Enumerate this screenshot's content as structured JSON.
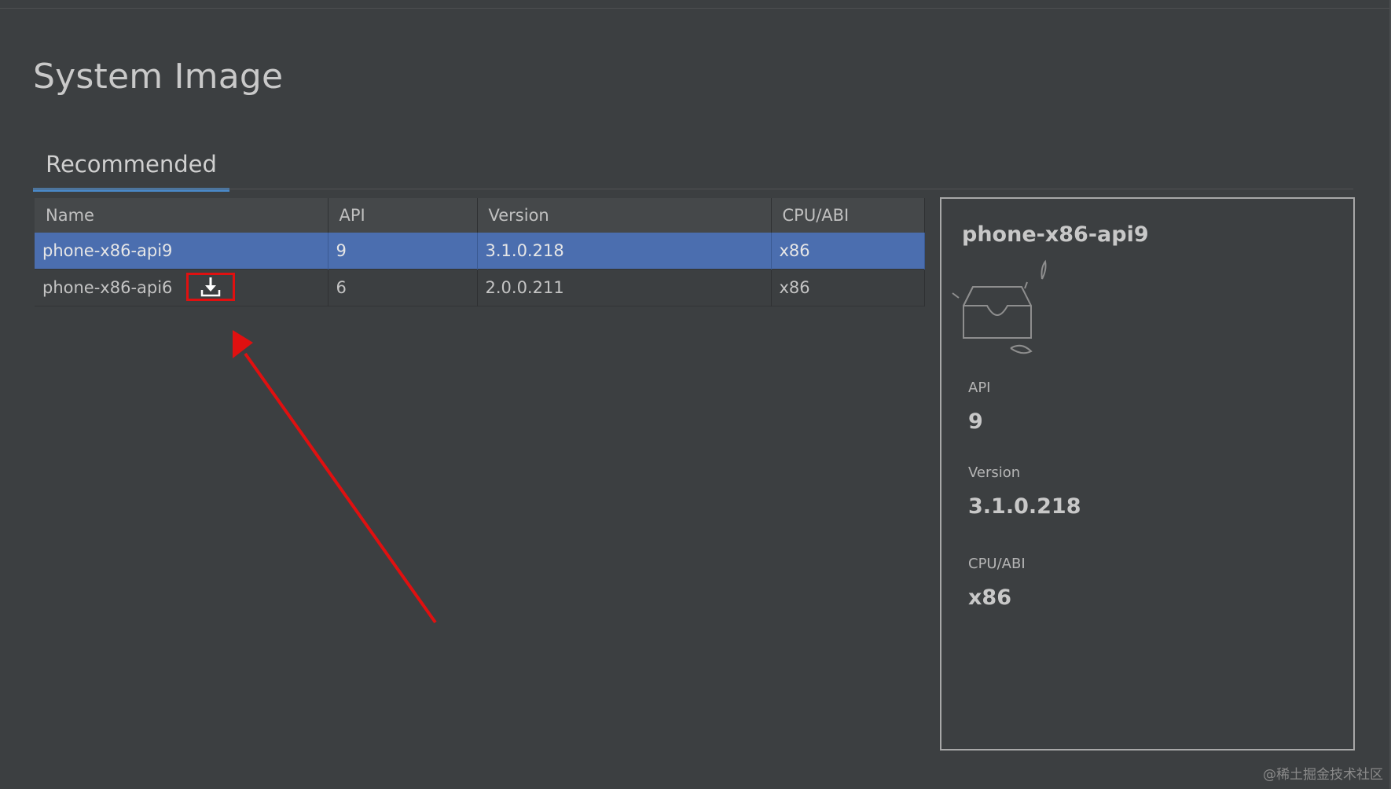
{
  "page": {
    "title": "System Image",
    "watermark": "@稀土掘金技术社区"
  },
  "tabs": [
    {
      "label": "Recommended",
      "active": true
    }
  ],
  "table": {
    "columns": [
      "Name",
      "API",
      "Version",
      "CPU/ABI"
    ],
    "rows": [
      {
        "name": "phone-x86-api9",
        "api": "9",
        "version": "3.1.0.218",
        "abi": "x86",
        "selected": true,
        "download": false
      },
      {
        "name": "phone-x86-api6",
        "api": "6",
        "version": "2.0.0.211",
        "abi": "x86",
        "selected": false,
        "download": true
      }
    ],
    "download_icon": "download-icon"
  },
  "details": {
    "title": "phone-x86-api9",
    "illustration_icon": "empty-inbox-icon",
    "fields": [
      {
        "label": "API",
        "value": "9"
      },
      {
        "label": "Version",
        "value": "3.1.0.218"
      },
      {
        "label": "CPU/ABI",
        "value": "x86"
      }
    ]
  },
  "colors": {
    "background": "#3c3f41",
    "selected_row": "#4b6eaf",
    "tab_accent": "#4a88c7",
    "annotation_red": "#e01010"
  }
}
